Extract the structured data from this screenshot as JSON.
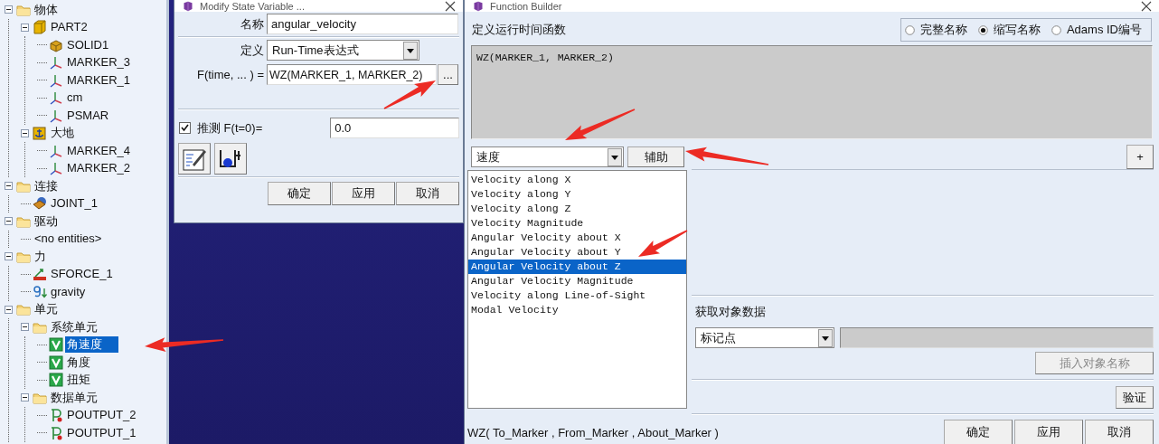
{
  "tree": {
    "items": [
      {
        "label": "物体",
        "kind": "folder",
        "expanded": true,
        "selected": false,
        "children": [
          {
            "label": "PART2",
            "kind": "part",
            "expanded": true,
            "selected": false,
            "children": [
              {
                "label": "SOLID1",
                "kind": "solid",
                "selected": false
              },
              {
                "label": "MARKER_3",
                "kind": "marker",
                "selected": false
              },
              {
                "label": "MARKER_1",
                "kind": "marker",
                "selected": false
              },
              {
                "label": "cm",
                "kind": "marker",
                "selected": false
              },
              {
                "label": "PSMAR",
                "kind": "marker",
                "selected": false
              }
            ]
          },
          {
            "label": "大地",
            "kind": "ground",
            "expanded": true,
            "selected": false,
            "children": [
              {
                "label": "MARKER_4",
                "kind": "marker",
                "selected": false
              },
              {
                "label": "MARKER_2",
                "kind": "marker",
                "selected": false
              }
            ]
          }
        ]
      },
      {
        "label": "连接",
        "kind": "folder",
        "expanded": true,
        "selected": false,
        "children": [
          {
            "label": "JOINT_1",
            "kind": "joint",
            "selected": false
          }
        ]
      },
      {
        "label": "驱动",
        "kind": "folder",
        "expanded": true,
        "selected": false,
        "children": [
          {
            "label": "<no entities>",
            "kind": "none",
            "selected": false
          }
        ]
      },
      {
        "label": "力",
        "kind": "folder",
        "expanded": true,
        "selected": false,
        "children": [
          {
            "label": "SFORCE_1",
            "kind": "force",
            "selected": false
          },
          {
            "label": "gravity",
            "kind": "gravity",
            "selected": false
          }
        ]
      },
      {
        "label": "单元",
        "kind": "folder",
        "expanded": true,
        "selected": false,
        "children": [
          {
            "label": "系统单元",
            "kind": "folder",
            "expanded": true,
            "selected": false,
            "children": [
              {
                "label": "角速度",
                "kind": "variable",
                "selected": true
              },
              {
                "label": "角度",
                "kind": "variable",
                "selected": false
              },
              {
                "label": "扭矩",
                "kind": "variable",
                "selected": false
              }
            ]
          },
          {
            "label": "数据单元",
            "kind": "folder",
            "expanded": true,
            "selected": false,
            "children": [
              {
                "label": "POUTPUT_2",
                "kind": "output",
                "selected": false
              },
              {
                "label": "POUTPUT_1",
                "kind": "output",
                "selected": false
              }
            ]
          }
        ]
      }
    ]
  },
  "modify_dialog": {
    "title": "Modify State Variable ...",
    "name_label": "名称",
    "name_value": "angular_velocity",
    "definition_label": "定义",
    "definition_value": "Run-Time表达式",
    "function_label": "F(time, ... ) =",
    "function_value": "WZ(MARKER_1, MARKER_2)",
    "browse_button": "...",
    "guess": {
      "label": "推测 F(t=0)=",
      "checked": true,
      "value": "0.0"
    },
    "buttons": [
      "确定",
      "应用",
      "取消"
    ]
  },
  "function_builder": {
    "title": "Function Builder",
    "heading": "定义运行时间函数",
    "name_modes": [
      {
        "label": "完整名称",
        "selected": false
      },
      {
        "label": "缩写名称",
        "selected": true
      },
      {
        "label": "Adams ID编号",
        "selected": false
      }
    ],
    "expression": "WZ(MARKER_1, MARKER_2)",
    "category": "速度",
    "assist_button": "辅助",
    "more_button": "+",
    "functions": [
      {
        "label": "Velocity along X",
        "selected": false
      },
      {
        "label": "Velocity along Y",
        "selected": false
      },
      {
        "label": "Velocity along Z",
        "selected": false
      },
      {
        "label": "Velocity Magnitude",
        "selected": false
      },
      {
        "label": "Angular Velocity about X",
        "selected": false
      },
      {
        "label": "Angular Velocity about Y",
        "selected": false
      },
      {
        "label": "Angular Velocity about Z",
        "selected": true
      },
      {
        "label": "Angular Velocity Magnitude",
        "selected": false
      },
      {
        "label": "Velocity along Line-of-Sight",
        "selected": false
      },
      {
        "label": "Modal Velocity",
        "selected": false
      }
    ],
    "object_data": {
      "heading": "获取对象数据",
      "type": "标记点",
      "insert_button": {
        "label": "插入对象名称",
        "disabled": true
      }
    },
    "verify_button": "验证",
    "signature": "WZ( To_Marker , From_Marker , About_Marker )",
    "buttons": [
      "确定",
      "应用",
      "取消"
    ]
  }
}
